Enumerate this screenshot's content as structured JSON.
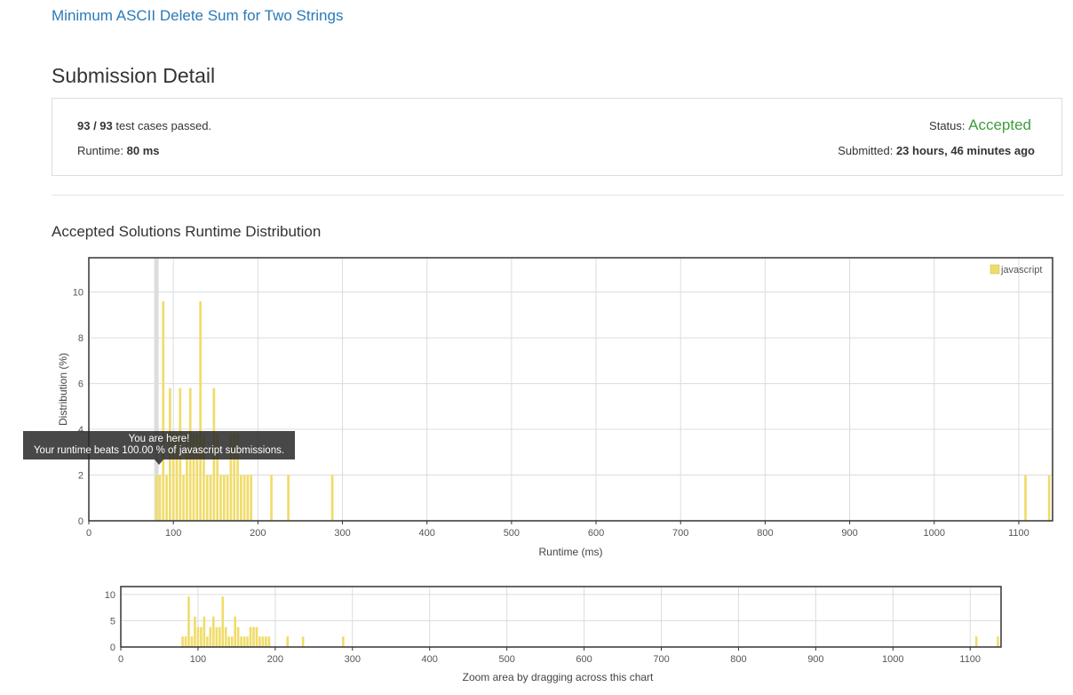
{
  "header": {
    "problem_link": "Minimum ASCII Delete Sum for Two Strings",
    "page_title": "Submission Detail"
  },
  "detail": {
    "passed": "93 / 93",
    "passed_suffix": " test cases passed.",
    "runtime_label": "Runtime: ",
    "runtime_value": "80 ms",
    "status_label": "Status: ",
    "status_value": "Accepted",
    "submitted_label": "Submitted: ",
    "submitted_value": "23 hours, 46 minutes ago"
  },
  "section": {
    "title": "Accepted Solutions Runtime Distribution"
  },
  "tooltip": {
    "line1": "You are here!",
    "line2": "Your runtime beats 100.00 % of javascript submissions."
  },
  "zoom_hint": "Zoom area by dragging across this chart",
  "colors": {
    "bar": "#f0dc6a",
    "accent_link": "#2a7ab8",
    "accepted": "#3e9d3e",
    "marker": "#dddddd"
  },
  "chart_data": [
    {
      "type": "bar",
      "xlabel": "Runtime (ms)",
      "ylabel": "Distribution (%)",
      "xlim": [
        0,
        1140
      ],
      "ylim": [
        0,
        11.5
      ],
      "xticks": [
        0,
        100,
        200,
        300,
        400,
        500,
        600,
        700,
        800,
        900,
        1000,
        1100
      ],
      "yticks": [
        0,
        2,
        4,
        6,
        8,
        10
      ],
      "grid": true,
      "legend": "top-right",
      "marker_x": 80,
      "series": [
        {
          "name": "javascript",
          "x": [
            80,
            84,
            88,
            92,
            96,
            100,
            104,
            108,
            112,
            116,
            120,
            124,
            128,
            132,
            136,
            140,
            144,
            148,
            152,
            156,
            160,
            164,
            168,
            172,
            176,
            180,
            184,
            188,
            192,
            216,
            236,
            288,
            1108,
            1136
          ],
          "values": [
            2,
            2,
            9.6,
            2,
            5.8,
            3.8,
            3.8,
            5.8,
            2,
            3.8,
            5.8,
            3.8,
            3.8,
            9.6,
            3.8,
            2,
            2,
            5.8,
            3.8,
            2,
            2,
            2,
            3.8,
            3.8,
            3.8,
            2,
            2,
            2,
            2,
            2,
            2,
            2,
            2,
            2
          ]
        }
      ]
    },
    {
      "type": "bar",
      "xlim": [
        0,
        1140
      ],
      "ylim": [
        0,
        11.5
      ],
      "xticks": [
        0,
        100,
        200,
        300,
        400,
        500,
        600,
        700,
        800,
        900,
        1000,
        1100
      ],
      "yticks": [
        0,
        5,
        10
      ],
      "grid": true,
      "series": [
        {
          "x": [
            80,
            84,
            88,
            92,
            96,
            100,
            104,
            108,
            112,
            116,
            120,
            124,
            128,
            132,
            136,
            140,
            144,
            148,
            152,
            156,
            160,
            164,
            168,
            172,
            176,
            180,
            184,
            188,
            192,
            216,
            236,
            288,
            1108,
            1136
          ],
          "values": [
            2,
            2,
            9.6,
            2,
            5.8,
            3.8,
            3.8,
            5.8,
            2,
            3.8,
            5.8,
            3.8,
            3.8,
            9.6,
            3.8,
            2,
            2,
            5.8,
            3.8,
            2,
            2,
            2,
            3.8,
            3.8,
            3.8,
            2,
            2,
            2,
            2,
            2,
            2,
            2,
            2,
            2
          ]
        }
      ]
    }
  ]
}
